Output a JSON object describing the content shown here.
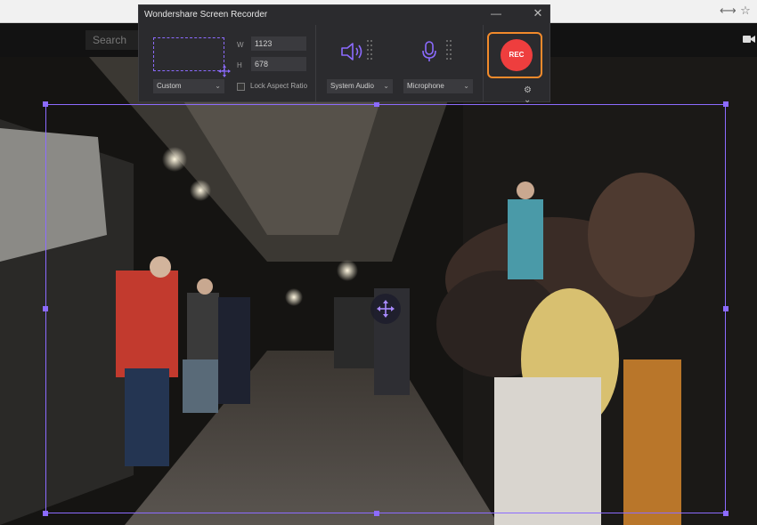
{
  "browser": {
    "search_placeholder": "Search",
    "translate_icon": "translate-icon",
    "bookmark_icon": "star-icon",
    "camera_icon": "video-camera-icon"
  },
  "recorder": {
    "title": "Wondershare Screen Recorder",
    "width_label": "W",
    "height_label": "H",
    "width_value": "1123",
    "height_value": "678",
    "region_mode": "Custom",
    "lock_aspect_label": "Lock Aspect Ratio",
    "lock_aspect_checked": false,
    "system_audio_label": "System Audio",
    "microphone_label": "Microphone",
    "rec_label": "REC",
    "accent_color": "#8c6bff",
    "rec_color": "#ee3e3e",
    "rec_ring_color": "#f28a2b"
  }
}
